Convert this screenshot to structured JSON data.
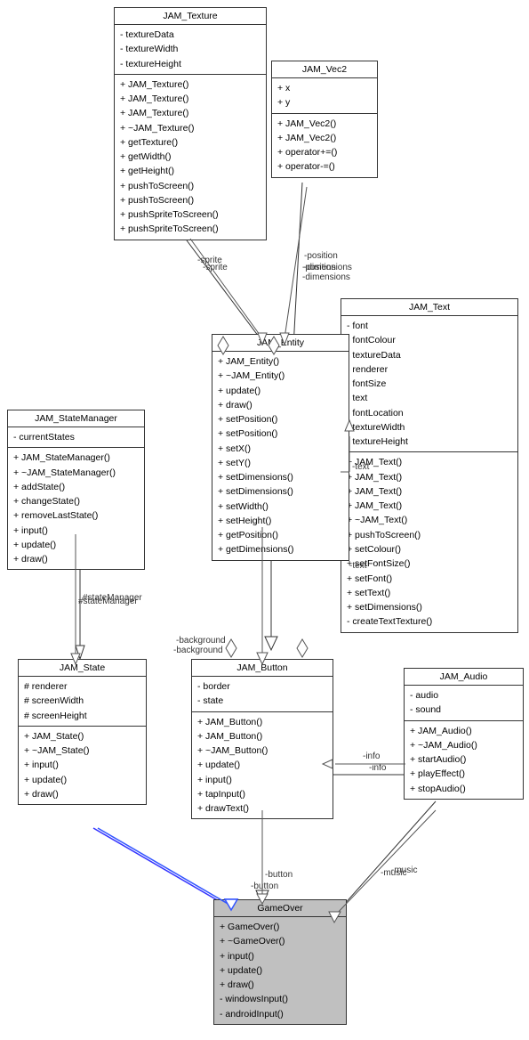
{
  "classes": {
    "jam_texture": {
      "title": "JAM_Texture",
      "attributes": [
        "- textureData",
        "- textureWidth",
        "- textureHeight"
      ],
      "methods": [
        "+ JAM_Texture()",
        "+ JAM_Texture()",
        "+ JAM_Texture()",
        "+ ~JAM_Texture()",
        "+ getTexture()",
        "+ getWidth()",
        "+ getHeight()",
        "+ pushToScreen()",
        "+ pushToScreen()",
        "+ pushSpriteToScreen()",
        "+ pushSpriteToScreen()"
      ]
    },
    "jam_vec2": {
      "title": "JAM_Vec2",
      "attributes": [
        "+ x",
        "+ y"
      ],
      "methods": [
        "+ JAM_Vec2()",
        "+ JAM_Vec2()",
        "+ operator+=()",
        "+ operator-=()"
      ]
    },
    "jam_text": {
      "title": "JAM_Text",
      "attributes": [
        "- font",
        "- fontColour",
        "- textureData",
        "- renderer",
        "- fontSize",
        "- text",
        "- fontLocation",
        "- textureWidth",
        "- textureHeight"
      ],
      "methods": [
        "+ JAM_Text()",
        "+ JAM_Text()",
        "+ JAM_Text()",
        "+ JAM_Text()",
        "+ ~JAM_Text()",
        "+ pushToScreen()",
        "+ setColour()",
        "+ setFontSize()",
        "+ setFont()",
        "+ setText()",
        "+ setDimensions()",
        "- createTextTexture()"
      ]
    },
    "jam_entity": {
      "title": "JAM_Entity",
      "attributes": [],
      "methods": [
        "+ JAM_Entity()",
        "+ ~JAM_Entity()",
        "+ update()",
        "+ draw()",
        "+ setPosition()",
        "+ setPosition()",
        "+ setX()",
        "+ setY()",
        "+ setDimensions()",
        "+ setDimensions()",
        "+ setWidth()",
        "+ setHeight()",
        "+ getPosition()",
        "+ getDimensions()"
      ]
    },
    "jam_statemanager": {
      "title": "JAM_StateManager",
      "attributes": [
        "- currentStates"
      ],
      "methods": [
        "+ JAM_StateManager()",
        "+ ~JAM_StateManager()",
        "+ addState()",
        "+ changeState()",
        "+ removeLastState()",
        "+ input()",
        "+ update()",
        "+ draw()"
      ]
    },
    "jam_state": {
      "title": "JAM_State",
      "attributes": [
        "# renderer",
        "# screenWidth",
        "# screenHeight"
      ],
      "methods": [
        "+ JAM_State()",
        "+ ~JAM_State()",
        "+ input()",
        "+ update()",
        "+ draw()"
      ]
    },
    "jam_button": {
      "title": "JAM_Button",
      "attributes": [
        "- border",
        "- state"
      ],
      "methods": [
        "+ JAM_Button()",
        "+ JAM_Button()",
        "+ ~JAM_Button()",
        "+ update()",
        "+ input()",
        "+ tapInput()",
        "+ drawText()"
      ]
    },
    "jam_audio": {
      "title": "JAM_Audio",
      "attributes": [
        "- audio",
        "- sound"
      ],
      "methods": [
        "+ JAM_Audio()",
        "+ ~JAM_Audio()",
        "+ startAudio()",
        "+ playEffect()",
        "+ stopAudio()"
      ]
    },
    "gameover": {
      "title": "GameOver",
      "attributes": [],
      "methods": [
        "+ GameOver()",
        "+ ~GameOver()",
        "+ input()",
        "+ update()",
        "+ draw()",
        "- windowsInput()",
        "- androidInput()"
      ]
    }
  },
  "labels": {
    "sprite": "-sprite",
    "position_dimensions": "-position\n-dimensions",
    "text": "-text",
    "statemanager": "#stateManager",
    "background": "-background",
    "info": "-info",
    "button": "-button",
    "music": "-music"
  }
}
